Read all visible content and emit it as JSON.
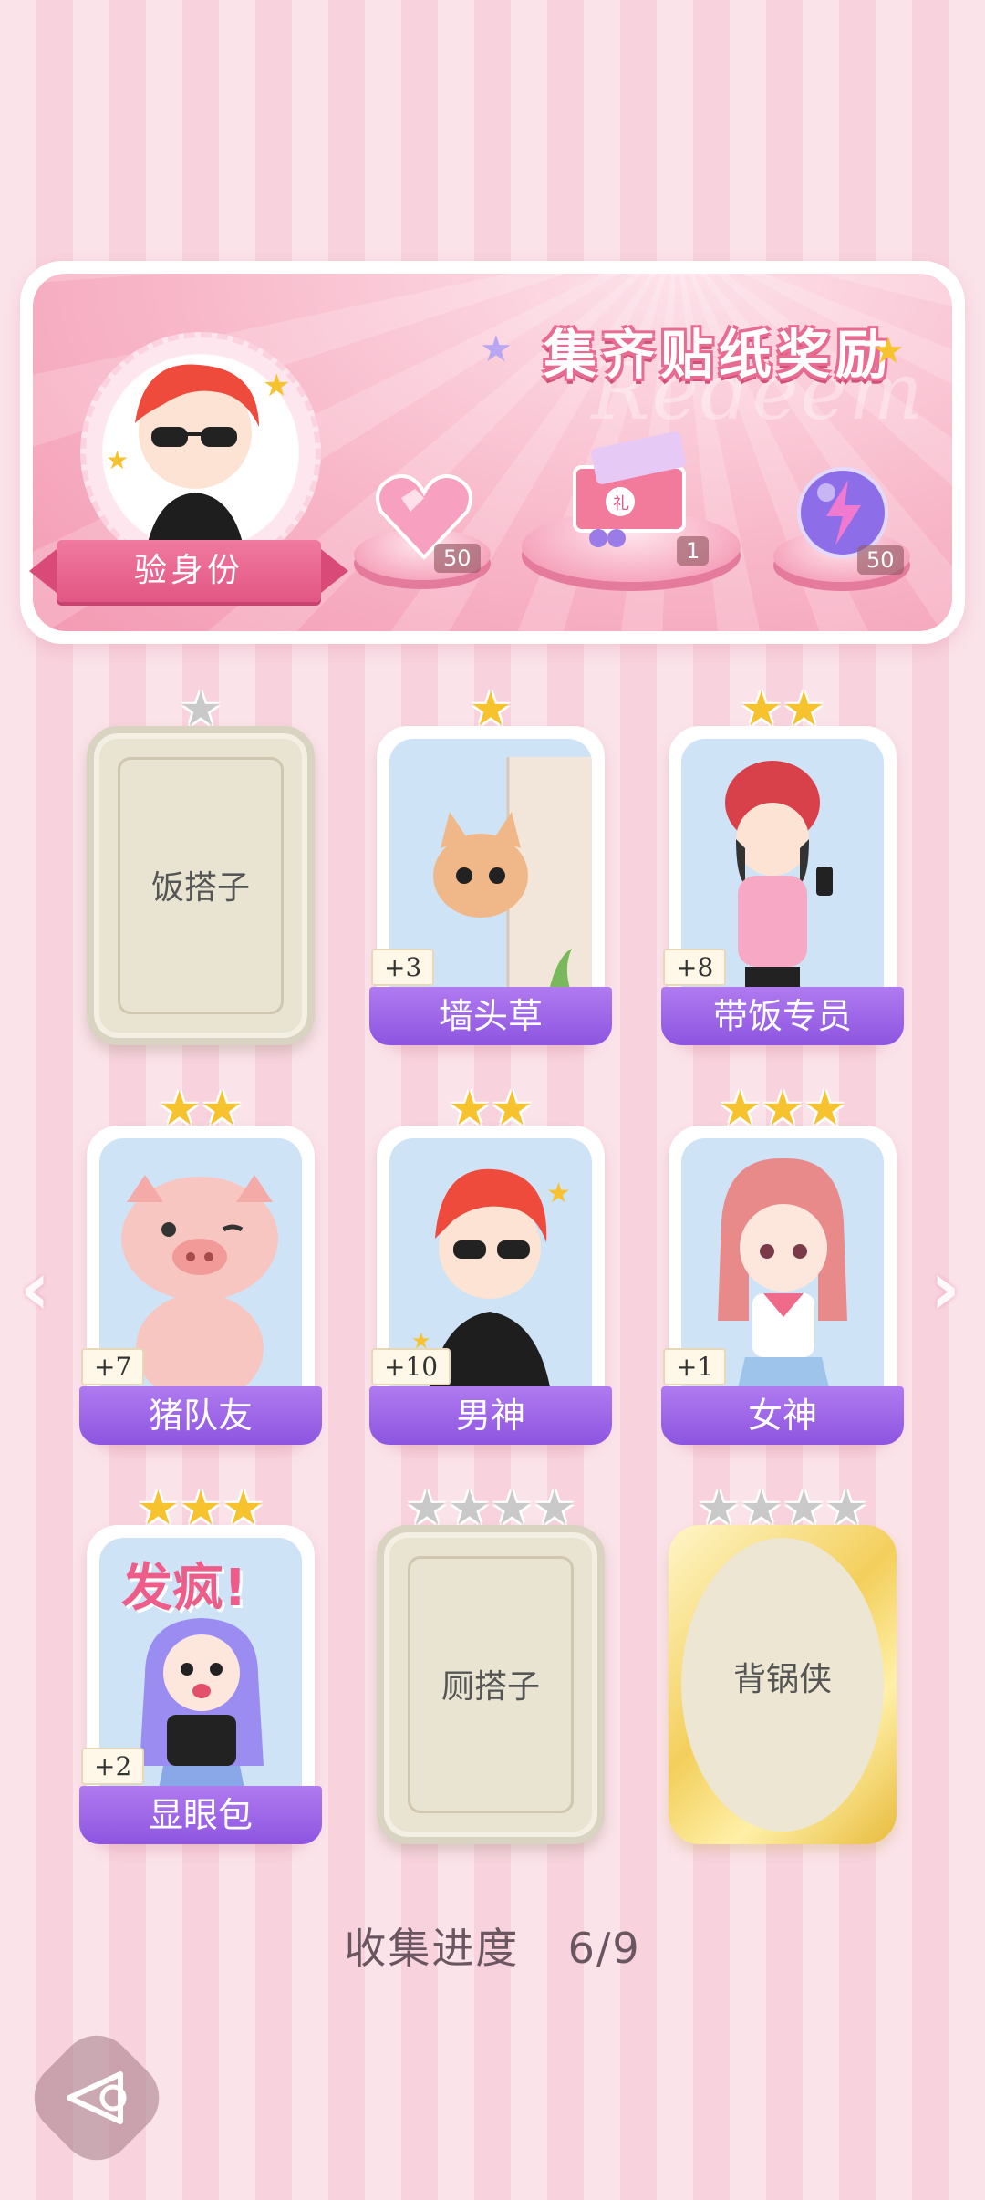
{
  "banner": {
    "title": "集齐贴纸奖励",
    "watermark": "Redeem",
    "identity_button": "验身份",
    "rewards": [
      {
        "icon": "pink-heart-gem-icon",
        "count": "50"
      },
      {
        "icon": "gift-box-icon",
        "count": "1"
      },
      {
        "icon": "lightning-orb-icon",
        "count": "50"
      }
    ]
  },
  "cards": [
    {
      "label": "饭搭子",
      "stars": 1,
      "unlocked": false,
      "plus": null,
      "style": "locked"
    },
    {
      "label": "墙头草",
      "stars": 1,
      "unlocked": true,
      "plus": "+3",
      "icon": "cat-peeking-icon"
    },
    {
      "label": "带饭专员",
      "stars": 2,
      "unlocked": true,
      "plus": "+8",
      "icon": "girl-backpack-icon"
    },
    {
      "label": "猪队友",
      "stars": 2,
      "unlocked": true,
      "plus": "+7",
      "icon": "pig-icon"
    },
    {
      "label": "男神",
      "stars": 2,
      "unlocked": true,
      "plus": "+10",
      "icon": "boy-sunglasses-icon"
    },
    {
      "label": "女神",
      "stars": 3,
      "unlocked": true,
      "plus": "+1",
      "icon": "girl-sailor-icon"
    },
    {
      "label": "显眼包",
      "stars": 3,
      "unlocked": true,
      "plus": "+2",
      "icon": "crazy-girl-icon",
      "art_text": "发疯!"
    },
    {
      "label": "厕搭子",
      "stars": 4,
      "unlocked": false,
      "plus": null,
      "style": "locked"
    },
    {
      "label": "背锅侠",
      "stars": 4,
      "unlocked": false,
      "plus": null,
      "style": "gold-locked"
    }
  ],
  "progress": {
    "label": "收集进度",
    "value": "6/9"
  },
  "colors": {
    "accent": "#e25684",
    "label_purple": "#8d55e0",
    "star_gold": "#f6c22e"
  }
}
